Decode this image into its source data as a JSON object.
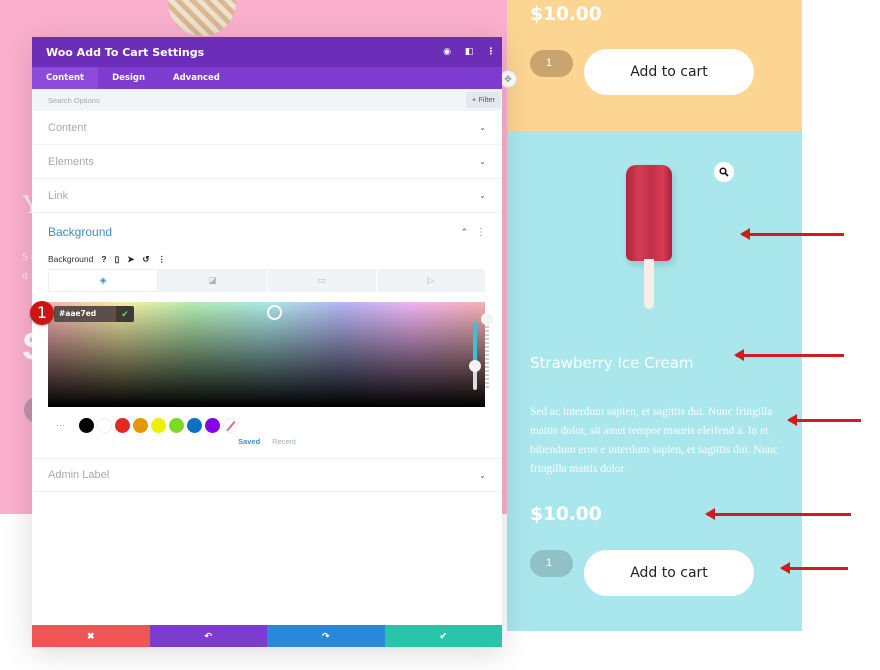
{
  "modal": {
    "title": "Woo Add To Cart Settings",
    "header_icons": [
      "focus-icon",
      "split-view-icon",
      "more-vertical-icon"
    ],
    "tabs": [
      {
        "label": "Content",
        "active": true
      },
      {
        "label": "Design",
        "active": false
      },
      {
        "label": "Advanced",
        "active": false
      }
    ],
    "search": {
      "placeholder": "Search Options",
      "filter_label": "+ Filter"
    },
    "sections": [
      {
        "label": "Content"
      },
      {
        "label": "Elements"
      },
      {
        "label": "Link"
      }
    ],
    "background": {
      "title": "Background",
      "field_label": "Background",
      "field_icons": [
        "help-icon",
        "mobile-icon",
        "cursor-icon",
        "reset-icon",
        "more-icon"
      ],
      "type_tabs": [
        "color",
        "gradient",
        "image",
        "video"
      ],
      "active_type": "color",
      "hex_value": "#aae7ed",
      "step_badge": "1",
      "swatches": [
        "#000000",
        "#ffffff",
        "#e02b20",
        "#e09900",
        "#edf000",
        "#7cda24",
        "#0c71c3",
        "#8300e9"
      ],
      "more_label": "···",
      "saved_label": "Saved",
      "recent_label": "Recent"
    },
    "admin_label": "Admin Label",
    "footer": [
      {
        "name": "discard",
        "icon": "✖",
        "color": "#ef5555"
      },
      {
        "name": "undo",
        "icon": "↶",
        "color": "#7e3bd0"
      },
      {
        "name": "redo",
        "icon": "↷",
        "color": "#2b87da"
      },
      {
        "name": "save",
        "icon": "✔",
        "color": "#29c4a9"
      }
    ]
  },
  "page": {
    "pink_fragments": {
      "heading": "Y",
      "text": "S t d",
      "big": "S"
    },
    "products": [
      {
        "bg": "#fcd592",
        "price": "$10.00",
        "quantity": "1",
        "button": "Add to cart"
      },
      {
        "bg": "#aae7ed",
        "title": "Strawberry Ice Cream",
        "description": "Sed ac interdum sapien, et sagittis dui. Nunc fringilla mattis dolor, sit amet tempor mauris eleifend a. In et bibendum eros e interdum sapien, et sagittis dui. Nunc fringilla mattis dolor",
        "price": "$10.00",
        "quantity": "1",
        "button": "Add to cart"
      }
    ]
  }
}
